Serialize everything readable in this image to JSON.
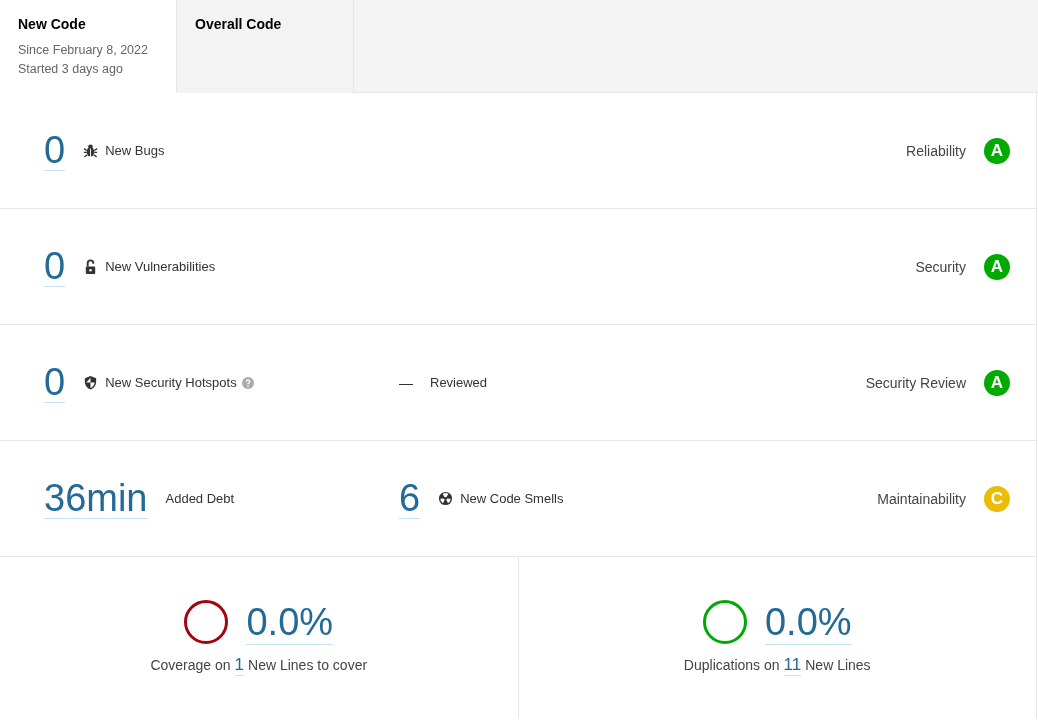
{
  "tabs": [
    {
      "label": "New Code",
      "selected": true,
      "lines": [
        "Since February 8, 2022",
        "Started 3 days ago"
      ]
    },
    {
      "label": "Overall Code",
      "selected": false
    }
  ],
  "rows": [
    {
      "kind": "bugs",
      "value": "0",
      "label": "New Bugs",
      "rating": "Reliability",
      "grade": "A",
      "color": "#00aa00"
    },
    {
      "kind": "vulnerabilities",
      "value": "0",
      "label": "New Vulnerabilities",
      "rating": "Security",
      "grade": "A",
      "color": "#00aa00"
    },
    {
      "kind": "hotspots",
      "value": "0",
      "label": "New Security Hotspots",
      "middle": {
        "kind": "reviewed",
        "value": "—",
        "label": "Reviewed"
      },
      "rating": "Security Review",
      "grade": "A",
      "color": "#00aa00"
    },
    {
      "kind": "debt",
      "value": "36min",
      "label": "Added Debt",
      "middle": {
        "kind": "smells",
        "value": "6",
        "label": "New Code Smells"
      },
      "rating": "Maintainability",
      "grade": "C",
      "color": "#eabe06"
    }
  ],
  "measures": [
    {
      "value": "0.0%",
      "prefix": "Coverage on",
      "count": "1",
      "suffix": "New Lines to cover",
      "color": "#a4030f"
    },
    {
      "value": "0.0%",
      "prefix": "Duplications on",
      "count": "11",
      "suffix": "New Lines",
      "color": "#00aa00"
    }
  ]
}
